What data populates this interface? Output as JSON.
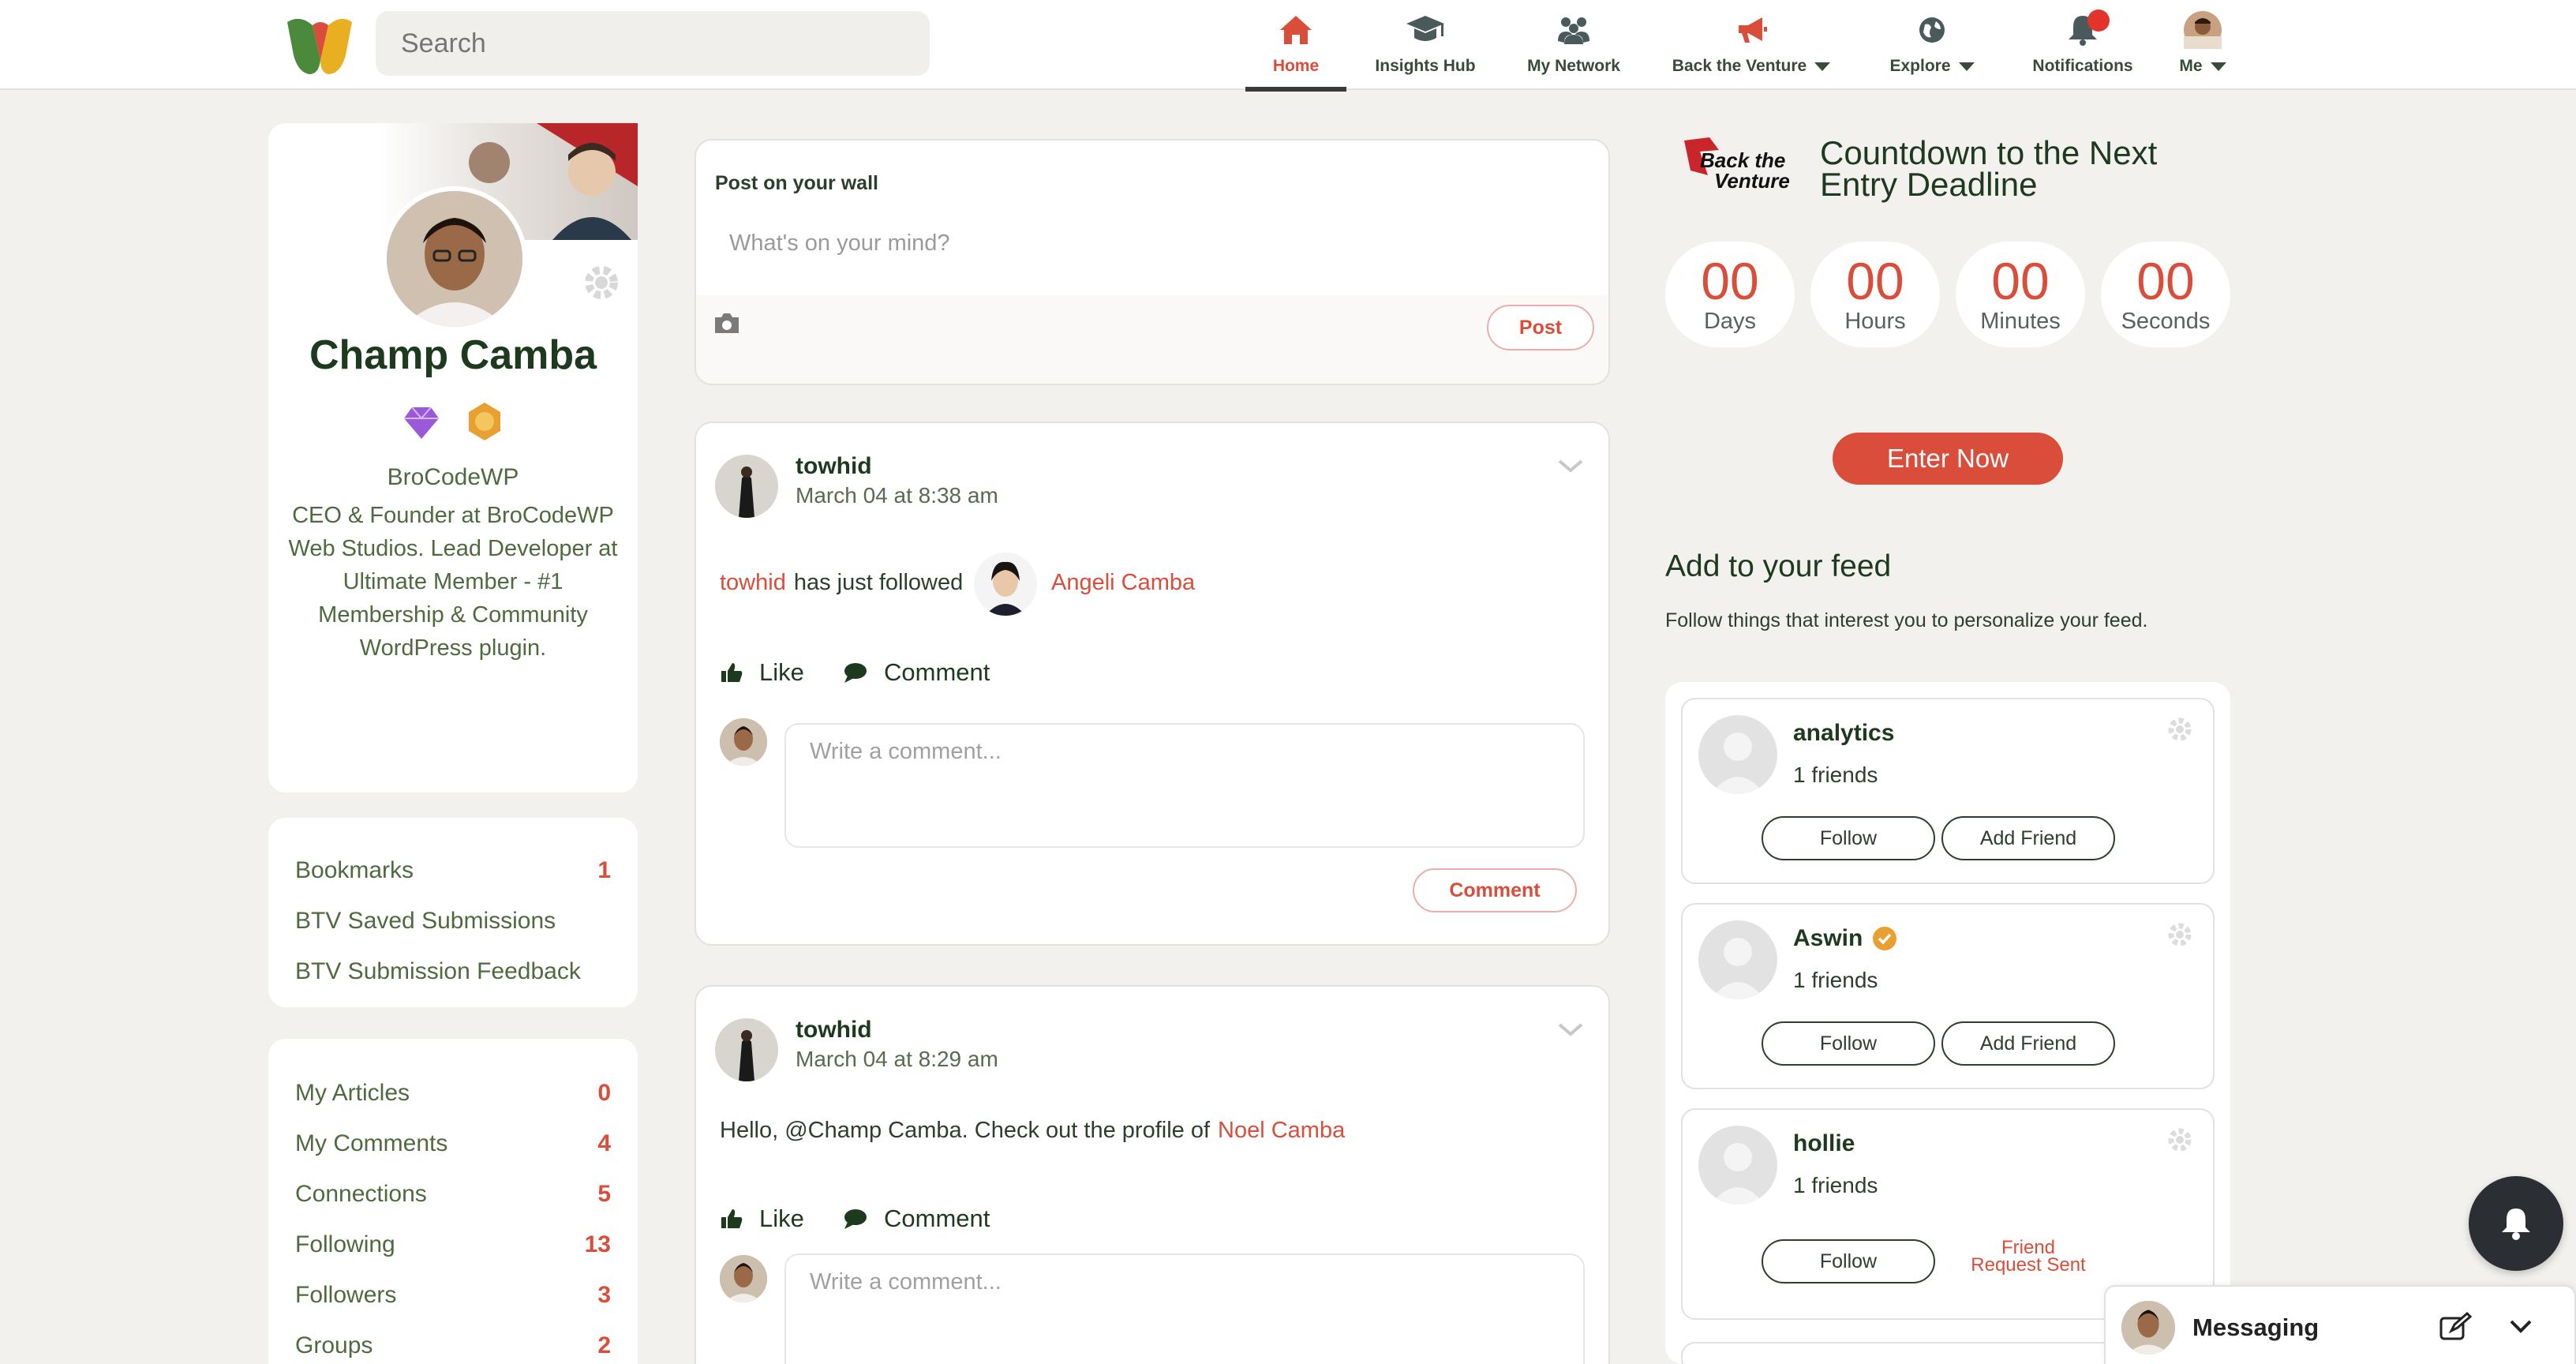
{
  "nav": {
    "search_placeholder": "Search",
    "items": [
      {
        "label": "Home",
        "icon": "home-icon"
      },
      {
        "label": "Insights Hub",
        "icon": "graduation-cap-icon"
      },
      {
        "label": "My Network",
        "icon": "people-icon"
      },
      {
        "label": "Back the Venture",
        "icon": "megaphone-icon"
      },
      {
        "label": "Explore",
        "icon": "globe-icon"
      },
      {
        "label": "Notifications",
        "icon": "bell-icon"
      },
      {
        "label": "Me",
        "icon": "avatar"
      }
    ]
  },
  "profile": {
    "name": "Champ Camba",
    "company": "BroCodeWP",
    "description": "CEO & Founder at BroCodeWP Web Studios. Lead Developer at Ultimate Member - #1 Membership & Community WordPress plugin."
  },
  "shortcuts": [
    {
      "label": "Bookmarks",
      "count": "1"
    },
    {
      "label": "BTV Saved Submissions",
      "count": ""
    },
    {
      "label": "BTV Submission Feedback",
      "count": ""
    }
  ],
  "stats": [
    {
      "label": "My Articles",
      "count": "0"
    },
    {
      "label": "My Comments",
      "count": "4"
    },
    {
      "label": "Connections",
      "count": "5"
    },
    {
      "label": "Following",
      "count": "13"
    },
    {
      "label": "Followers",
      "count": "3"
    },
    {
      "label": "Groups",
      "count": "2"
    }
  ],
  "composer": {
    "title": "Post on your wall",
    "placeholder": "What's on your mind?",
    "post_label": "Post"
  },
  "posts": [
    {
      "author": "towhid",
      "date": "March 04 at 8:38 am",
      "text_user": "towhid",
      "text_middle": "has just followed",
      "target": "Angeli Camba",
      "like": "Like",
      "comment": "Comment",
      "comment_placeholder": "Write a comment...",
      "comment_button": "Comment"
    },
    {
      "author": "towhid",
      "date": "March 04 at 8:29 am",
      "text_prefix": "Hello, @Champ Camba. Check out the profile of",
      "target": "Noel Camba",
      "like": "Like",
      "comment": "Comment",
      "comment_placeholder": "Write a comment..."
    }
  ],
  "countdown": {
    "logo_line1": "Back the",
    "logo_line2": "Venture",
    "title": "Countdown to the Next Entry Deadline",
    "units": [
      {
        "value": "00",
        "label": "Days"
      },
      {
        "value": "00",
        "label": "Hours"
      },
      {
        "value": "00",
        "label": "Minutes"
      },
      {
        "value": "00",
        "label": "Seconds"
      }
    ],
    "cta": "Enter Now"
  },
  "feed": {
    "title": "Add to your feed",
    "subtitle": "Follow things that interest you to personalize your feed.",
    "items": [
      {
        "name": "analytics",
        "friends": "1 friends",
        "follow": "Follow",
        "add_friend": "Add Friend"
      },
      {
        "name": "Aswin",
        "friends": "1 friends",
        "follow": "Follow",
        "add_friend": "Add Friend"
      },
      {
        "name": "hollie",
        "friends": "1 friends",
        "follow": "Follow",
        "request_sent": "Friend Request Sent"
      }
    ]
  },
  "messaging": {
    "label": "Messaging"
  },
  "colors": {
    "accent": "#d94d3a",
    "text": "#1e3a1e",
    "background": "#f2f1ee"
  }
}
